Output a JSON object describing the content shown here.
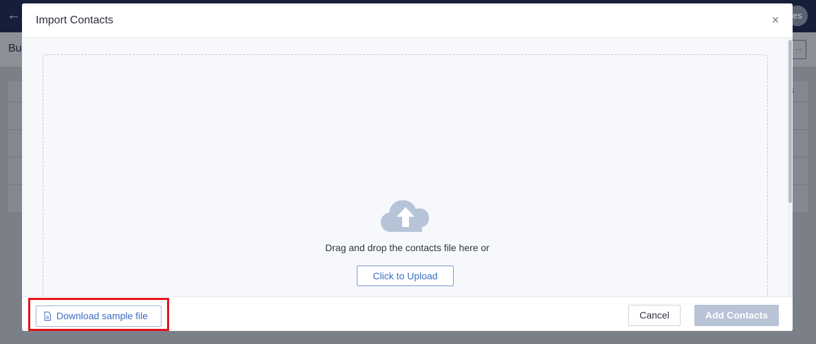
{
  "background": {
    "back_icon": "←",
    "avatar_text": "es",
    "page_title": "Bu",
    "more_icon": "··",
    "sort_icon": "↓"
  },
  "modal": {
    "title": "Import Contacts",
    "close_icon": "×",
    "dropzone": {
      "icon": "cloud-upload-icon",
      "text": "Drag and drop the contacts file here or",
      "upload_label": "Click to Upload"
    },
    "footer": {
      "download_label": "Download sample file",
      "download_icon": "file-icon",
      "cancel_label": "Cancel",
      "add_label": "Add Contacts"
    }
  },
  "colors": {
    "accent": "#3b6cc7",
    "highlight": "#e4121b",
    "disabled_primary": "#b8c3d6"
  }
}
